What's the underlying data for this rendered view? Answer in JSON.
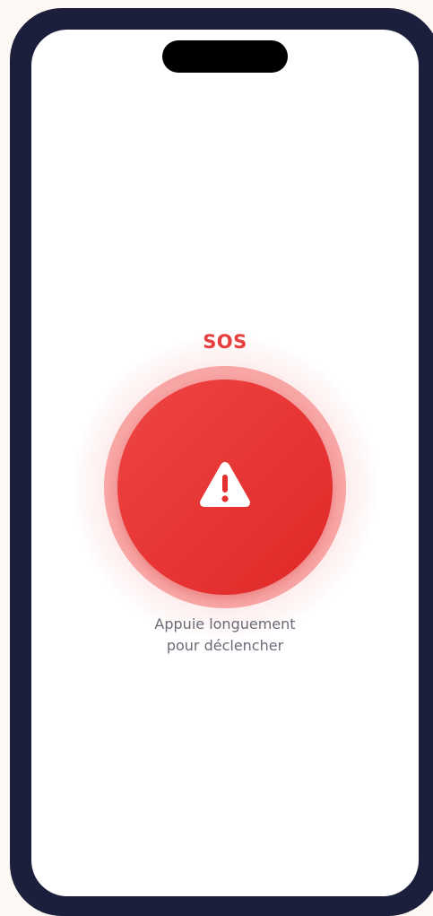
{
  "sos": {
    "title": "SOS",
    "hint_line1": "Appuie longuement",
    "hint_line2": "pour déclencher",
    "icon": "warning-triangle-icon"
  },
  "colors": {
    "accent": "#e53e3e",
    "ring": "#f8a5a5",
    "frame": "#1b1f3b",
    "hint_text": "#6b6b78"
  }
}
